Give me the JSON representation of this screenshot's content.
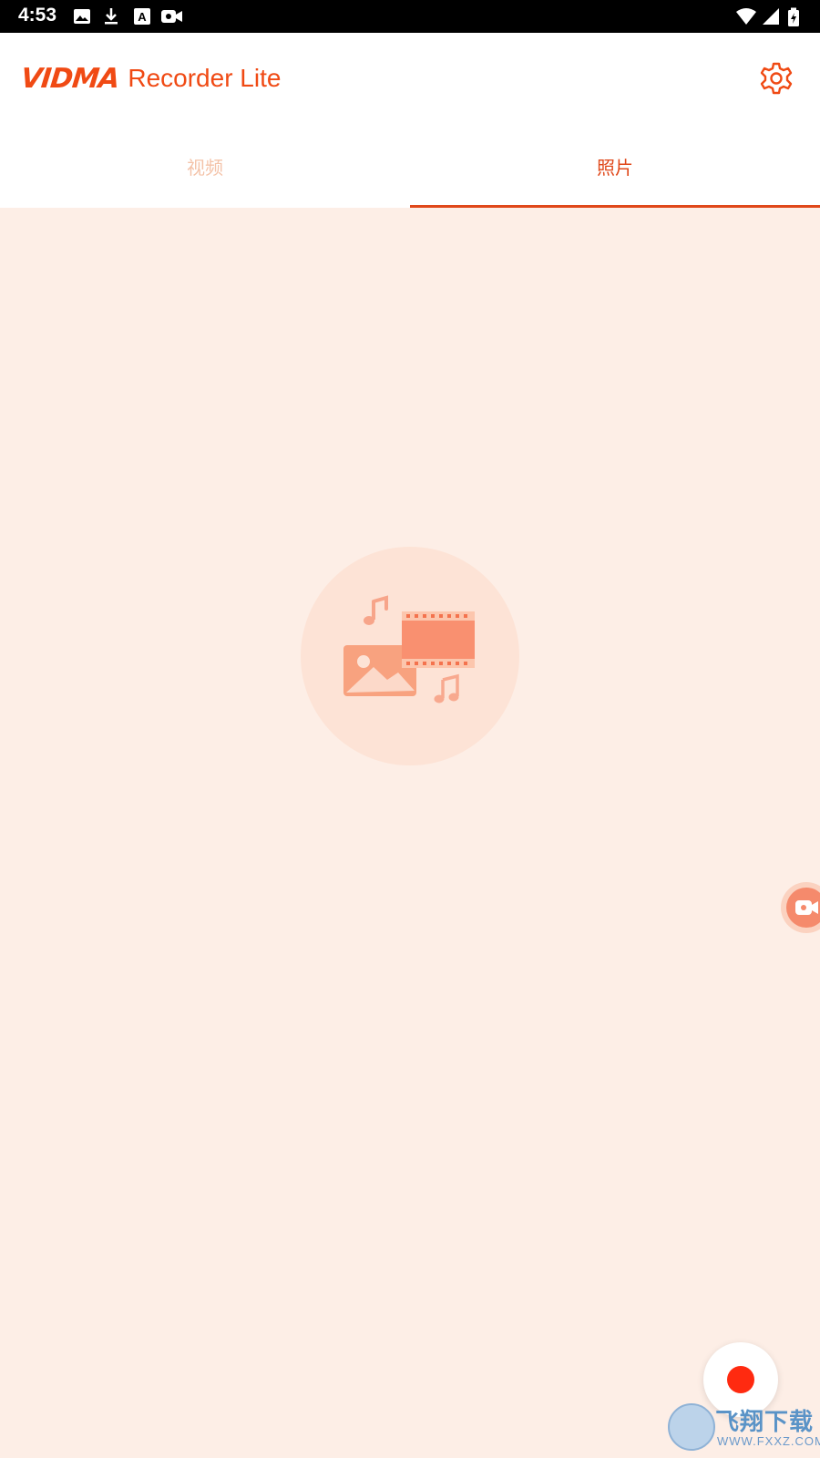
{
  "status_bar": {
    "time": "4:53",
    "left_icons": [
      "image-icon",
      "download-icon",
      "accessibility-text-icon",
      "video-camera-icon"
    ],
    "right_icons": [
      "wifi-icon",
      "signal-icon",
      "battery-charging-icon"
    ]
  },
  "app_bar": {
    "brand": "VIDMA",
    "app_name": "Recorder Lite",
    "settings_icon": "gear-icon",
    "accent_color": "#f04a14"
  },
  "tabs": [
    {
      "label": "视频",
      "selected": false
    },
    {
      "label": "照片",
      "selected": true
    }
  ],
  "empty_state": {
    "illustration_icons": [
      "music-note-icon",
      "image-icon",
      "film-strip-icon",
      "music-note-icon"
    ]
  },
  "floating": {
    "side_handle_icon": "video-camera-icon",
    "record_button_color": "#ff2a10"
  },
  "watermark": {
    "text": "飞翔下载",
    "url": "WWW.FXXZ.COM"
  }
}
